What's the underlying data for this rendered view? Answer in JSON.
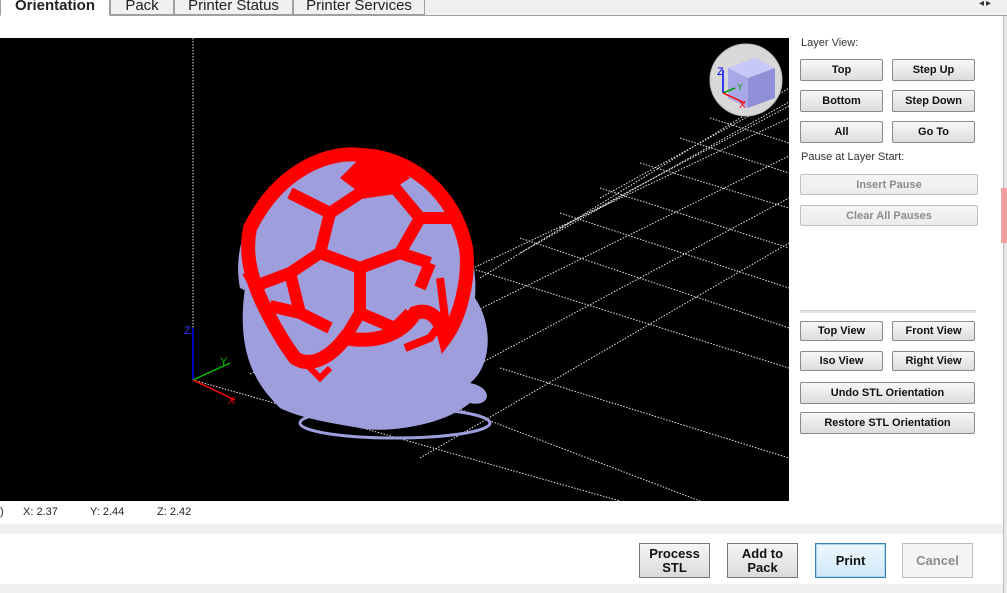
{
  "tabs": [
    {
      "label": "Orientation",
      "active": true
    },
    {
      "label": "Pack",
      "active": false
    },
    {
      "label": "Printer Status",
      "active": false
    },
    {
      "label": "Printer Services",
      "active": false
    }
  ],
  "viewport": {
    "background": "#000000",
    "model_color": "#9e9edd",
    "highlight_color": "#ff0000",
    "axis_labels": {
      "z": "Z",
      "y": "Y",
      "x": "X"
    }
  },
  "coords": {
    "x": "X:  2.37",
    "y": "Y:  2.44",
    "z": "Z:  2.42"
  },
  "layer_view": {
    "label": "Layer View:",
    "top": "Top",
    "step_up": "Step Up",
    "bottom": "Bottom",
    "step_down": "Step Down",
    "all": "All",
    "go_to": "Go To"
  },
  "pause": {
    "label": "Pause at Layer Start:",
    "insert": "Insert Pause",
    "clear": "Clear All Pauses"
  },
  "views": {
    "top_view": "Top View",
    "front_view": "Front View",
    "iso_view": "Iso View",
    "right_view": "Right View",
    "undo": "Undo STL Orientation",
    "restore": "Restore STL Orientation"
  },
  "bottom": {
    "process_line1": "Process",
    "process_line2": "STL",
    "add_line1": "Add to",
    "add_line2": "Pack",
    "print": "Print",
    "cancel": "Cancel"
  }
}
